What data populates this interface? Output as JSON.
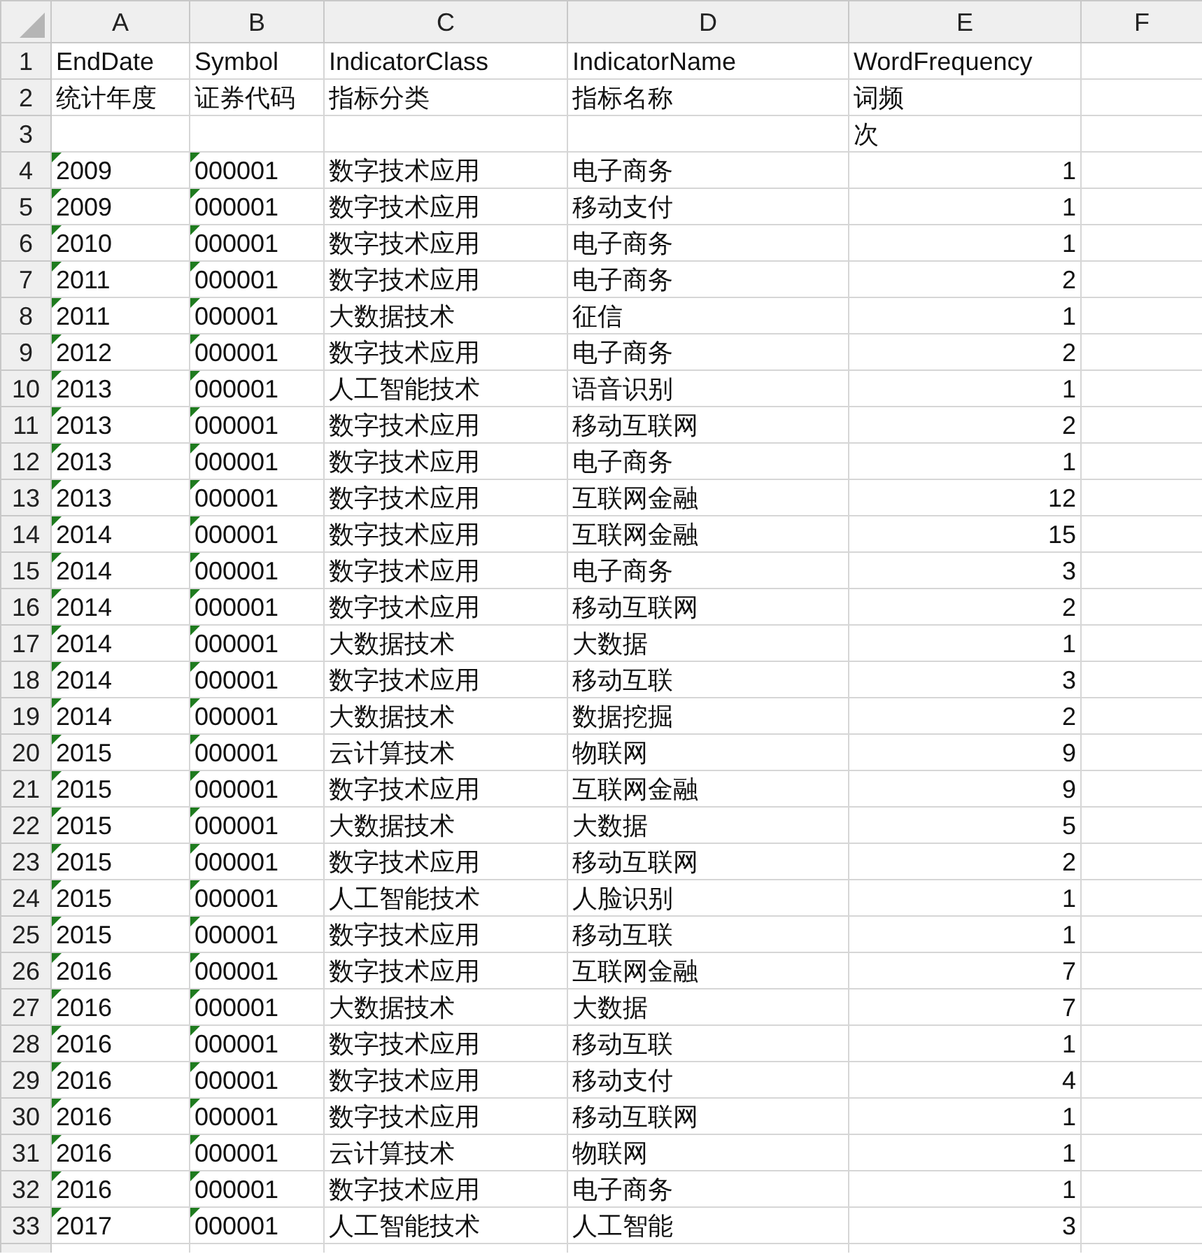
{
  "columns": [
    "A",
    "B",
    "C",
    "D",
    "E",
    "F"
  ],
  "rows": [
    {
      "number": "1",
      "kind": "header",
      "cells": {
        "A": {
          "text": "EndDate",
          "flag": false
        },
        "B": {
          "text": "Symbol",
          "flag": false
        },
        "C": {
          "text": "IndicatorClass",
          "flag": false
        },
        "D": {
          "text": "IndicatorName",
          "flag": false
        },
        "E": {
          "text": "WordFrequency",
          "flag": false
        }
      }
    },
    {
      "number": "2",
      "kind": "header",
      "cells": {
        "A": {
          "text": "统计年度",
          "flag": false
        },
        "B": {
          "text": "证券代码",
          "flag": false
        },
        "C": {
          "text": "指标分类",
          "flag": false
        },
        "D": {
          "text": "指标名称",
          "flag": false
        },
        "E": {
          "text": "词频",
          "flag": false
        }
      }
    },
    {
      "number": "3",
      "kind": "header",
      "cells": {
        "E": {
          "text": "次",
          "flag": false
        }
      }
    },
    {
      "number": "4",
      "kind": "data",
      "cells": {
        "A": {
          "text": "2009",
          "flag": true
        },
        "B": {
          "text": "000001",
          "flag": true
        },
        "C": {
          "text": "数字技术应用",
          "flag": false
        },
        "D": {
          "text": "电子商务",
          "flag": false
        },
        "E": {
          "text": "1",
          "flag": false
        }
      }
    },
    {
      "number": "5",
      "kind": "data",
      "cells": {
        "A": {
          "text": "2009",
          "flag": true
        },
        "B": {
          "text": "000001",
          "flag": true
        },
        "C": {
          "text": "数字技术应用",
          "flag": false
        },
        "D": {
          "text": "移动支付",
          "flag": false
        },
        "E": {
          "text": "1",
          "flag": false
        }
      }
    },
    {
      "number": "6",
      "kind": "data",
      "cells": {
        "A": {
          "text": "2010",
          "flag": true
        },
        "B": {
          "text": "000001",
          "flag": true
        },
        "C": {
          "text": "数字技术应用",
          "flag": false
        },
        "D": {
          "text": "电子商务",
          "flag": false
        },
        "E": {
          "text": "1",
          "flag": false
        }
      }
    },
    {
      "number": "7",
      "kind": "data",
      "cells": {
        "A": {
          "text": "2011",
          "flag": true
        },
        "B": {
          "text": "000001",
          "flag": true
        },
        "C": {
          "text": "数字技术应用",
          "flag": false
        },
        "D": {
          "text": "电子商务",
          "flag": false
        },
        "E": {
          "text": "2",
          "flag": false
        }
      }
    },
    {
      "number": "8",
      "kind": "data",
      "cells": {
        "A": {
          "text": "2011",
          "flag": true
        },
        "B": {
          "text": "000001",
          "flag": true
        },
        "C": {
          "text": "大数据技术",
          "flag": false
        },
        "D": {
          "text": "征信",
          "flag": false
        },
        "E": {
          "text": "1",
          "flag": false
        }
      }
    },
    {
      "number": "9",
      "kind": "data",
      "cells": {
        "A": {
          "text": "2012",
          "flag": true
        },
        "B": {
          "text": "000001",
          "flag": true
        },
        "C": {
          "text": "数字技术应用",
          "flag": false
        },
        "D": {
          "text": "电子商务",
          "flag": false
        },
        "E": {
          "text": "2",
          "flag": false
        }
      }
    },
    {
      "number": "10",
      "kind": "data",
      "cells": {
        "A": {
          "text": "2013",
          "flag": true
        },
        "B": {
          "text": "000001",
          "flag": true
        },
        "C": {
          "text": "人工智能技术",
          "flag": false
        },
        "D": {
          "text": "语音识别",
          "flag": false
        },
        "E": {
          "text": "1",
          "flag": false
        }
      }
    },
    {
      "number": "11",
      "kind": "data",
      "cells": {
        "A": {
          "text": "2013",
          "flag": true
        },
        "B": {
          "text": "000001",
          "flag": true
        },
        "C": {
          "text": "数字技术应用",
          "flag": false
        },
        "D": {
          "text": "移动互联网",
          "flag": false
        },
        "E": {
          "text": "2",
          "flag": false
        }
      }
    },
    {
      "number": "12",
      "kind": "data",
      "cells": {
        "A": {
          "text": "2013",
          "flag": true
        },
        "B": {
          "text": "000001",
          "flag": true
        },
        "C": {
          "text": "数字技术应用",
          "flag": false
        },
        "D": {
          "text": "电子商务",
          "flag": false
        },
        "E": {
          "text": "1",
          "flag": false
        }
      }
    },
    {
      "number": "13",
      "kind": "data",
      "cells": {
        "A": {
          "text": "2013",
          "flag": true
        },
        "B": {
          "text": "000001",
          "flag": true
        },
        "C": {
          "text": "数字技术应用",
          "flag": false
        },
        "D": {
          "text": "互联网金融",
          "flag": false
        },
        "E": {
          "text": "12",
          "flag": false
        }
      }
    },
    {
      "number": "14",
      "kind": "data",
      "cells": {
        "A": {
          "text": "2014",
          "flag": true
        },
        "B": {
          "text": "000001",
          "flag": true
        },
        "C": {
          "text": "数字技术应用",
          "flag": false
        },
        "D": {
          "text": "互联网金融",
          "flag": false
        },
        "E": {
          "text": "15",
          "flag": false
        }
      }
    },
    {
      "number": "15",
      "kind": "data",
      "cells": {
        "A": {
          "text": "2014",
          "flag": true
        },
        "B": {
          "text": "000001",
          "flag": true
        },
        "C": {
          "text": "数字技术应用",
          "flag": false
        },
        "D": {
          "text": "电子商务",
          "flag": false
        },
        "E": {
          "text": "3",
          "flag": false
        }
      }
    },
    {
      "number": "16",
      "kind": "data",
      "cells": {
        "A": {
          "text": "2014",
          "flag": true
        },
        "B": {
          "text": "000001",
          "flag": true
        },
        "C": {
          "text": "数字技术应用",
          "flag": false
        },
        "D": {
          "text": "移动互联网",
          "flag": false
        },
        "E": {
          "text": "2",
          "flag": false
        }
      }
    },
    {
      "number": "17",
      "kind": "data",
      "cells": {
        "A": {
          "text": "2014",
          "flag": true
        },
        "B": {
          "text": "000001",
          "flag": true
        },
        "C": {
          "text": "大数据技术",
          "flag": false
        },
        "D": {
          "text": "大数据",
          "flag": false
        },
        "E": {
          "text": "1",
          "flag": false
        }
      }
    },
    {
      "number": "18",
      "kind": "data",
      "cells": {
        "A": {
          "text": "2014",
          "flag": true
        },
        "B": {
          "text": "000001",
          "flag": true
        },
        "C": {
          "text": "数字技术应用",
          "flag": false
        },
        "D": {
          "text": "移动互联",
          "flag": false
        },
        "E": {
          "text": "3",
          "flag": false
        }
      }
    },
    {
      "number": "19",
      "kind": "data",
      "cells": {
        "A": {
          "text": "2014",
          "flag": true
        },
        "B": {
          "text": "000001",
          "flag": true
        },
        "C": {
          "text": "大数据技术",
          "flag": false
        },
        "D": {
          "text": "数据挖掘",
          "flag": false
        },
        "E": {
          "text": "2",
          "flag": false
        }
      }
    },
    {
      "number": "20",
      "kind": "data",
      "cells": {
        "A": {
          "text": "2015",
          "flag": true
        },
        "B": {
          "text": "000001",
          "flag": true
        },
        "C": {
          "text": "云计算技术",
          "flag": false
        },
        "D": {
          "text": "物联网",
          "flag": false
        },
        "E": {
          "text": "9",
          "flag": false
        }
      }
    },
    {
      "number": "21",
      "kind": "data",
      "cells": {
        "A": {
          "text": "2015",
          "flag": true
        },
        "B": {
          "text": "000001",
          "flag": true
        },
        "C": {
          "text": "数字技术应用",
          "flag": false
        },
        "D": {
          "text": "互联网金融",
          "flag": false
        },
        "E": {
          "text": "9",
          "flag": false
        }
      }
    },
    {
      "number": "22",
      "kind": "data",
      "cells": {
        "A": {
          "text": "2015",
          "flag": true
        },
        "B": {
          "text": "000001",
          "flag": true
        },
        "C": {
          "text": "大数据技术",
          "flag": false
        },
        "D": {
          "text": "大数据",
          "flag": false
        },
        "E": {
          "text": "5",
          "flag": false
        }
      }
    },
    {
      "number": "23",
      "kind": "data",
      "cells": {
        "A": {
          "text": "2015",
          "flag": true
        },
        "B": {
          "text": "000001",
          "flag": true
        },
        "C": {
          "text": "数字技术应用",
          "flag": false
        },
        "D": {
          "text": "移动互联网",
          "flag": false
        },
        "E": {
          "text": "2",
          "flag": false
        }
      }
    },
    {
      "number": "24",
      "kind": "data",
      "cells": {
        "A": {
          "text": "2015",
          "flag": true
        },
        "B": {
          "text": "000001",
          "flag": true
        },
        "C": {
          "text": "人工智能技术",
          "flag": false
        },
        "D": {
          "text": "人脸识别",
          "flag": false
        },
        "E": {
          "text": "1",
          "flag": false
        }
      }
    },
    {
      "number": "25",
      "kind": "data",
      "cells": {
        "A": {
          "text": "2015",
          "flag": true
        },
        "B": {
          "text": "000001",
          "flag": true
        },
        "C": {
          "text": "数字技术应用",
          "flag": false
        },
        "D": {
          "text": "移动互联",
          "flag": false
        },
        "E": {
          "text": "1",
          "flag": false
        }
      }
    },
    {
      "number": "26",
      "kind": "data",
      "cells": {
        "A": {
          "text": "2016",
          "flag": true
        },
        "B": {
          "text": "000001",
          "flag": true
        },
        "C": {
          "text": "数字技术应用",
          "flag": false
        },
        "D": {
          "text": "互联网金融",
          "flag": false
        },
        "E": {
          "text": "7",
          "flag": false
        }
      }
    },
    {
      "number": "27",
      "kind": "data",
      "cells": {
        "A": {
          "text": "2016",
          "flag": true
        },
        "B": {
          "text": "000001",
          "flag": true
        },
        "C": {
          "text": "大数据技术",
          "flag": false
        },
        "D": {
          "text": "大数据",
          "flag": false
        },
        "E": {
          "text": "7",
          "flag": false
        }
      }
    },
    {
      "number": "28",
      "kind": "data",
      "cells": {
        "A": {
          "text": "2016",
          "flag": true
        },
        "B": {
          "text": "000001",
          "flag": true
        },
        "C": {
          "text": "数字技术应用",
          "flag": false
        },
        "D": {
          "text": "移动互联",
          "flag": false
        },
        "E": {
          "text": "1",
          "flag": false
        }
      }
    },
    {
      "number": "29",
      "kind": "data",
      "cells": {
        "A": {
          "text": "2016",
          "flag": true
        },
        "B": {
          "text": "000001",
          "flag": true
        },
        "C": {
          "text": "数字技术应用",
          "flag": false
        },
        "D": {
          "text": "移动支付",
          "flag": false
        },
        "E": {
          "text": "4",
          "flag": false
        }
      }
    },
    {
      "number": "30",
      "kind": "data",
      "cells": {
        "A": {
          "text": "2016",
          "flag": true
        },
        "B": {
          "text": "000001",
          "flag": true
        },
        "C": {
          "text": "数字技术应用",
          "flag": false
        },
        "D": {
          "text": "移动互联网",
          "flag": false
        },
        "E": {
          "text": "1",
          "flag": false
        }
      }
    },
    {
      "number": "31",
      "kind": "data",
      "cells": {
        "A": {
          "text": "2016",
          "flag": true
        },
        "B": {
          "text": "000001",
          "flag": true
        },
        "C": {
          "text": "云计算技术",
          "flag": false
        },
        "D": {
          "text": "物联网",
          "flag": false
        },
        "E": {
          "text": "1",
          "flag": false
        }
      }
    },
    {
      "number": "32",
      "kind": "data",
      "cells": {
        "A": {
          "text": "2016",
          "flag": true
        },
        "B": {
          "text": "000001",
          "flag": true
        },
        "C": {
          "text": "数字技术应用",
          "flag": false
        },
        "D": {
          "text": "电子商务",
          "flag": false
        },
        "E": {
          "text": "1",
          "flag": false
        }
      }
    },
    {
      "number": "33",
      "kind": "data",
      "cells": {
        "A": {
          "text": "2017",
          "flag": true
        },
        "B": {
          "text": "000001",
          "flag": true
        },
        "C": {
          "text": "人工智能技术",
          "flag": false
        },
        "D": {
          "text": "人工智能",
          "flag": false
        },
        "E": {
          "text": "3",
          "flag": false
        }
      }
    }
  ]
}
